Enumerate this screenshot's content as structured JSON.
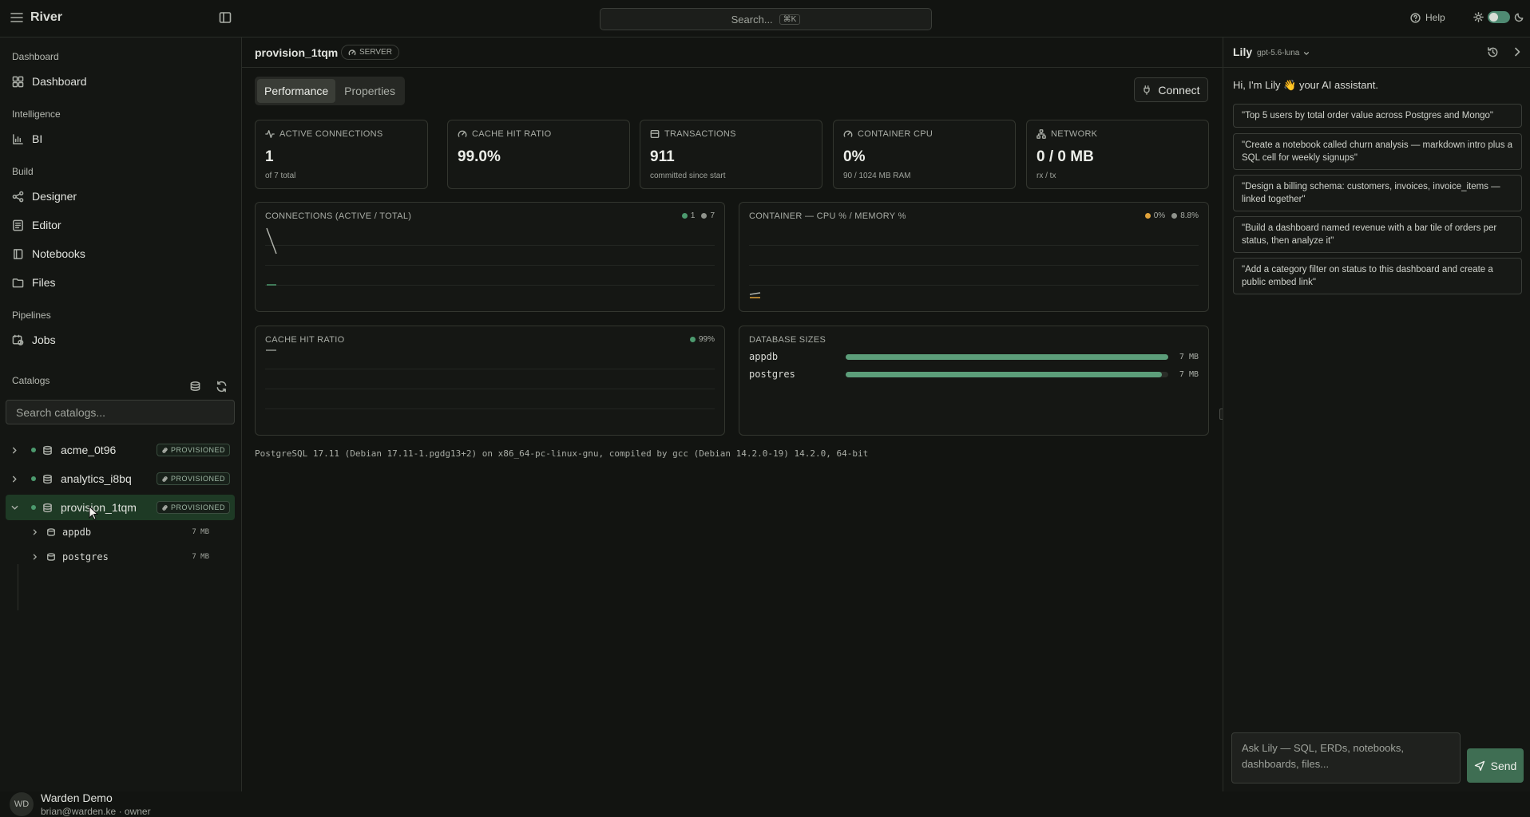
{
  "app": {
    "name": "River"
  },
  "topbar": {
    "search_placeholder": "Search...",
    "search_shortcut": "⌘K",
    "help_label": "Help"
  },
  "sidebar": {
    "sections": [
      {
        "title": "Dashboard",
        "items": [
          {
            "label": "Dashboard",
            "icon": "dashboard-icon"
          }
        ]
      },
      {
        "title": "Intelligence",
        "items": [
          {
            "label": "BI",
            "icon": "chart-icon"
          }
        ]
      },
      {
        "title": "Build",
        "items": [
          {
            "label": "Designer",
            "icon": "designer-icon"
          },
          {
            "label": "Editor",
            "icon": "editor-icon"
          },
          {
            "label": "Notebooks",
            "icon": "notebook-icon"
          },
          {
            "label": "Files",
            "icon": "folder-icon"
          }
        ]
      },
      {
        "title": "Pipelines",
        "items": [
          {
            "label": "Jobs",
            "icon": "jobs-icon"
          }
        ]
      }
    ],
    "catalogs_title": "Catalogs",
    "catalog_search_placeholder": "Search catalogs...",
    "catalogs": [
      {
        "name": "acme_0t96",
        "badge": "PROVISIONED",
        "expanded": false
      },
      {
        "name": "analytics_i8bq",
        "badge": "PROVISIONED",
        "expanded": false
      },
      {
        "name": "provision_1tqm",
        "badge": "PROVISIONED",
        "expanded": true,
        "children": [
          {
            "name": "appdb",
            "size": "7 MB"
          },
          {
            "name": "postgres",
            "size": "7 MB"
          }
        ]
      }
    ],
    "user": {
      "initials": "WD",
      "name": "Warden Demo",
      "email": "brian@warden.ke · owner"
    }
  },
  "main": {
    "title": "provision_1tqm",
    "server_badge": "SERVER",
    "tabs": [
      {
        "label": "Performance",
        "active": true
      },
      {
        "label": "Properties",
        "active": false
      }
    ],
    "connect_label": "Connect",
    "kpis": [
      {
        "label": "ACTIVE CONNECTIONS",
        "value": "1",
        "sub": "of 7 total",
        "icon": "activity-icon"
      },
      {
        "label": "CACHE HIT RATIO",
        "value": "99.0%",
        "sub": "",
        "icon": "gauge-icon"
      },
      {
        "label": "TRANSACTIONS",
        "value": "911",
        "sub": "committed since start",
        "icon": "database-icon"
      },
      {
        "label": "CONTAINER CPU",
        "value": "0%",
        "sub": "90 / 1024 MB RAM",
        "icon": "gauge-icon"
      },
      {
        "label": "NETWORK",
        "value": "0 / 0 MB",
        "sub": "rx / tx",
        "icon": "network-icon"
      }
    ],
    "panels": {
      "connections": {
        "title": "CONNECTIONS (ACTIVE / TOTAL)",
        "legend": [
          "1",
          "7"
        ]
      },
      "container": {
        "title": "CONTAINER — CPU % / MEMORY %",
        "legend": [
          "0%",
          "8.8%"
        ]
      },
      "cache": {
        "title": "CACHE HIT RATIO",
        "legend": [
          "99%"
        ]
      },
      "db_sizes": {
        "title": "DATABASE SIZES"
      }
    },
    "version": "PostgreSQL 17.11 (Debian 17.11-1.pgdg13+2) on x86_64-pc-linux-gnu, compiled by gcc (Debian 14.2.0-19) 14.2.0, 64-bit"
  },
  "chart_data": [
    {
      "type": "bar",
      "title": "DATABASE SIZES",
      "categories": [
        "appdb",
        "postgres"
      ],
      "values": [
        7,
        7
      ],
      "value_labels": [
        "7 MB",
        "7 MB"
      ],
      "fill_fraction": [
        1.0,
        0.98
      ]
    }
  ],
  "colors": {
    "accent": "#4f8a72",
    "series_green": "#4c9a6e",
    "series_orange": "#e0a23a",
    "series_gray": "#8f938c"
  },
  "assistant": {
    "name": "Lily",
    "model": "gpt-5.6-luna",
    "greeting": "Hi, I'm Lily 👋 your AI assistant.",
    "suggestions": [
      "\"Top 5 users by total order value across Postgres and Mongo\"",
      "\"Create a notebook called churn analysis — markdown intro plus a SQL cell for weekly signups\"",
      "\"Design a billing schema: customers, invoices, invoice_items — linked together\"",
      "\"Build a dashboard named revenue with a bar tile of orders per status, then analyze it\"",
      "\"Add a category filter on status to this dashboard and create a public embed link\""
    ],
    "input_placeholder": "Ask Lily — SQL, ERDs, notebooks, dashboards, files...",
    "send_label": "Send"
  }
}
